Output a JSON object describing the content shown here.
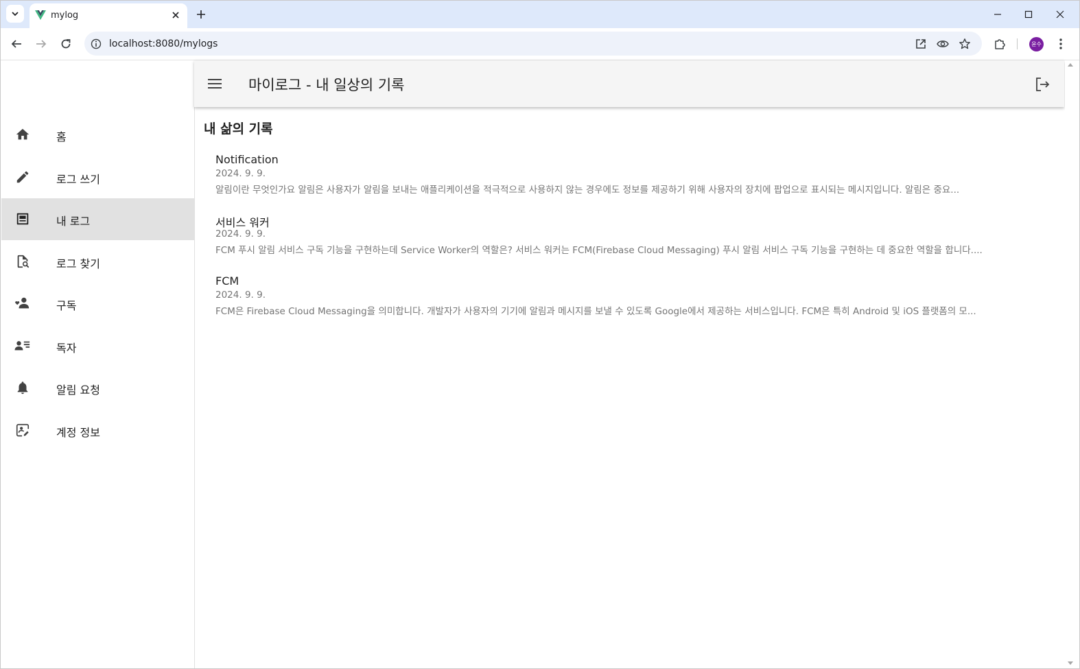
{
  "browser": {
    "tab_title": "mylog",
    "url": "localhost:8080/mylogs",
    "profile_initials": "윤수"
  },
  "colors": {
    "tabstrip_bg": "#dee9fb",
    "appbar_bg": "#f5f5f5",
    "active_nav_bg": "#e1e1e1",
    "avatar_bg": "#7a1ea1",
    "vue_green": "#41b883",
    "vue_dark": "#34495e"
  },
  "appbar": {
    "title": "마이로그 - 내 일상의 기록"
  },
  "sidebar": {
    "items": [
      {
        "label": "홈",
        "icon": "home-icon"
      },
      {
        "label": "로그 쓰기",
        "icon": "pencil-icon"
      },
      {
        "label": "내 로그",
        "icon": "article-icon",
        "active": true
      },
      {
        "label": "로그 찾기",
        "icon": "find-document-icon"
      },
      {
        "label": "구독",
        "icon": "person-heart-icon"
      },
      {
        "label": "독자",
        "icon": "person-list-icon"
      },
      {
        "label": "알림 요청",
        "icon": "bell-icon"
      },
      {
        "label": "계정 정보",
        "icon": "account-edit-icon"
      }
    ]
  },
  "main": {
    "section_title": "내 삶의 기록",
    "logs": [
      {
        "title": "Notification",
        "date": "2024. 9. 9.",
        "excerpt": "알림이란 무엇인가요 알림은 사용자가 알림을 보내는 애플리케이션을 적극적으로 사용하지 않는 경우에도 정보를 제공하기 위해 사용자의 장치에 팝업으로 표시되는 메시지입니다. 알림은 중요..."
      },
      {
        "title": "서비스 워커",
        "date": "2024. 9. 9.",
        "excerpt": "FCM 푸시 알림 서비스 구독 기능을 구현하는데 Service Worker의 역할은? 서비스 워커는 FCM(Firebase Cloud Messaging) 푸시 알림 서비스 구독 기능을 구현하는 데 중요한 역할을 합니다...."
      },
      {
        "title": "FCM",
        "date": "2024. 9. 9.",
        "excerpt": "FCM은 Firebase Cloud Messaging을 의미합니다. 개발자가 사용자의 기기에 알림과 메시지를 보낼 수 있도록 Google에서 제공하는 서비스입니다. FCM은 특히 Android 및 iOS 플랫폼의 모..."
      }
    ]
  }
}
